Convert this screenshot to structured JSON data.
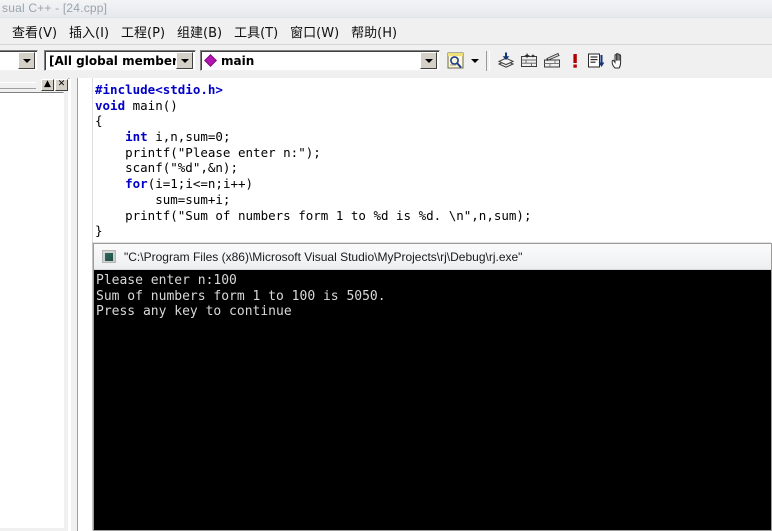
{
  "window": {
    "title": "sual C++ - [24.cpp]"
  },
  "menubar": {
    "items": [
      {
        "label": "查看(V)",
        "name": "menu-view"
      },
      {
        "label": "插入(I)",
        "name": "menu-insert"
      },
      {
        "label": "工程(P)",
        "name": "menu-project"
      },
      {
        "label": "组建(B)",
        "name": "menu-build"
      },
      {
        "label": "工具(T)",
        "name": "menu-tools"
      },
      {
        "label": "窗口(W)",
        "name": "menu-window"
      },
      {
        "label": "帮助(H)",
        "name": "menu-help"
      }
    ]
  },
  "toolbar": {
    "combo_file": {
      "value": "",
      "placeholder": ""
    },
    "combo_members": {
      "value": "[All global members"
    },
    "combo_function": {
      "value": "main",
      "icon": "magenta-diamond-icon"
    },
    "buttons": [
      {
        "name": "find-in-files-button",
        "icon": "find-in-files-icon"
      },
      {
        "name": "find-dropdown-button",
        "icon": "chevron-down-icon"
      },
      {
        "name": "compile-button",
        "icon": "compile-icon"
      },
      {
        "name": "build-button",
        "icon": "build-icon"
      },
      {
        "name": "build-execute-button",
        "icon": "build-execute-icon"
      },
      {
        "name": "stop-build-button",
        "icon": "red-exclamation-icon"
      },
      {
        "name": "go-button",
        "icon": "list-down-arrow-icon"
      },
      {
        "name": "insert-remove-breakpoint-button",
        "icon": "hand-icon"
      }
    ]
  },
  "workspace": {
    "minimize_label": "▲",
    "close_label": "✕"
  },
  "editor": {
    "lines": [
      [
        {
          "t": "pp",
          "s": "#include<stdio.h>"
        }
      ],
      [
        {
          "t": "kw",
          "s": "void"
        },
        {
          "t": "txt",
          "s": " main()"
        }
      ],
      [
        {
          "t": "txt",
          "s": "{"
        }
      ],
      [
        {
          "t": "txt",
          "s": "    "
        },
        {
          "t": "kw",
          "s": "int"
        },
        {
          "t": "txt",
          "s": " i,n,sum=0;"
        }
      ],
      [
        {
          "t": "txt",
          "s": "    printf(\"Please enter n:\");"
        }
      ],
      [
        {
          "t": "txt",
          "s": "    scanf(\"%d\",&n);"
        }
      ],
      [
        {
          "t": "txt",
          "s": "    "
        },
        {
          "t": "kw",
          "s": "for"
        },
        {
          "t": "txt",
          "s": "(i=1;i<=n;i++)"
        }
      ],
      [
        {
          "t": "txt",
          "s": "        sum=sum+i;"
        }
      ],
      [
        {
          "t": "txt",
          "s": "    printf(\"Sum of numbers form 1 to %d is %d. \\n\",n,sum);"
        }
      ],
      [
        {
          "t": "txt",
          "s": "}"
        }
      ]
    ]
  },
  "console": {
    "title": "\"C:\\Program Files (x86)\\Microsoft Visual Studio\\MyProjects\\rj\\Debug\\rj.exe\"",
    "output": [
      "Please enter n:100",
      "Sum of numbers form 1 to 100 is 5050.",
      "Press any key to continue"
    ]
  },
  "colors": {
    "keyword_blue": "#0000c8",
    "console_bg": "#000000",
    "console_fg": "#d8d8d8",
    "accent_magenta": "#b315b3",
    "chrome_gray": "#f0f0f0"
  }
}
